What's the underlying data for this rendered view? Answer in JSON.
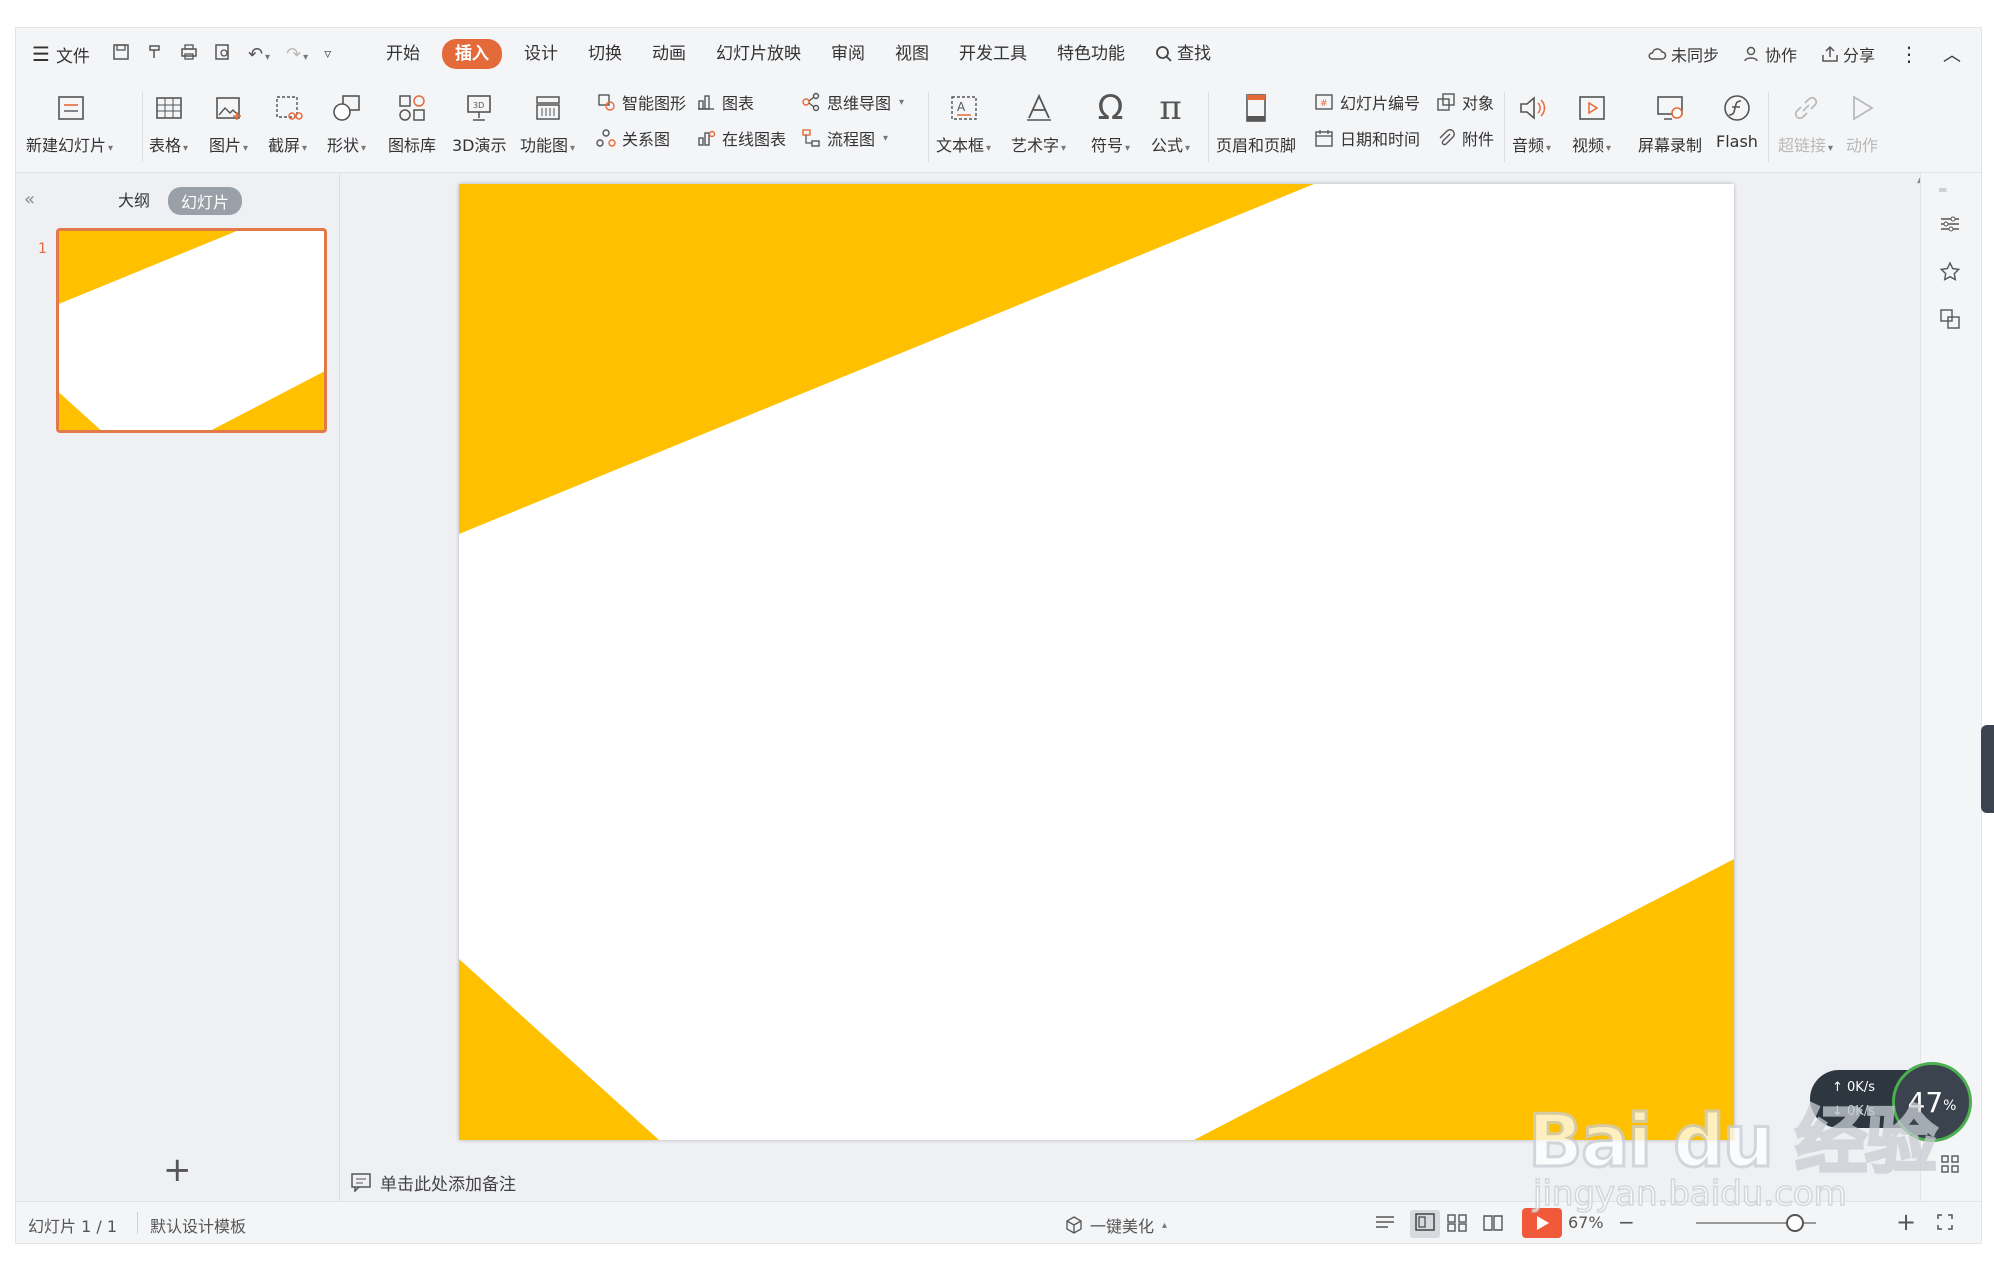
{
  "menu": {
    "file_label": "文件",
    "tabs": [
      {
        "label": "开始",
        "active": false
      },
      {
        "label": "插入",
        "active": true
      },
      {
        "label": "设计",
        "active": false
      },
      {
        "label": "切换",
        "active": false
      },
      {
        "label": "动画",
        "active": false
      },
      {
        "label": "幻灯片放映",
        "active": false
      },
      {
        "label": "审阅",
        "active": false
      },
      {
        "label": "视图",
        "active": false
      },
      {
        "label": "开发工具",
        "active": false
      },
      {
        "label": "特色功能",
        "active": false
      }
    ],
    "search_label": "查找",
    "sync_label": "未同步",
    "collab_label": "协作",
    "share_label": "分享"
  },
  "ribbon": {
    "new_slide": "新建幻灯片",
    "table": "表格",
    "picture": "图片",
    "screenshot": "截屏",
    "shape": "形状",
    "icon_lib": "图标库",
    "demo3d": "3D演示",
    "func_chart": "功能图",
    "smart_shape": "智能图形",
    "chart": "图表",
    "relation": "关系图",
    "online_chart": "在线图表",
    "mindmap": "思维导图",
    "flowchart": "流程图",
    "textbox": "文本框",
    "wordart": "艺术字",
    "symbol": "符号",
    "formula": "公式",
    "header_footer": "页眉和页脚",
    "slide_number": "幻灯片编号",
    "object": "对象",
    "datetime": "日期和时间",
    "attachment": "附件",
    "audio": "音频",
    "video": "视频",
    "screen_record": "屏幕录制",
    "flash": "Flash",
    "hyperlink": "超链接",
    "action": "动作"
  },
  "left_panel": {
    "outline_tab": "大纲",
    "slides_tab": "幻灯片",
    "slide_number": "1"
  },
  "notes": {
    "placeholder": "单击此处添加备注"
  },
  "status": {
    "slide_info": "幻灯片 1 / 1",
    "template": "默认设计模板",
    "beautify": "一键美化",
    "zoom": "67%"
  },
  "speed_widget": {
    "up": "0K/s",
    "down": "0K/s",
    "percent": "47",
    "percent_unit": "%"
  },
  "watermark": {
    "logo": "Bai du 经验",
    "url": "jingyan.baidu.com"
  },
  "colors": {
    "accent": "#e56a3a",
    "slide_yellow": "#ffc000"
  }
}
